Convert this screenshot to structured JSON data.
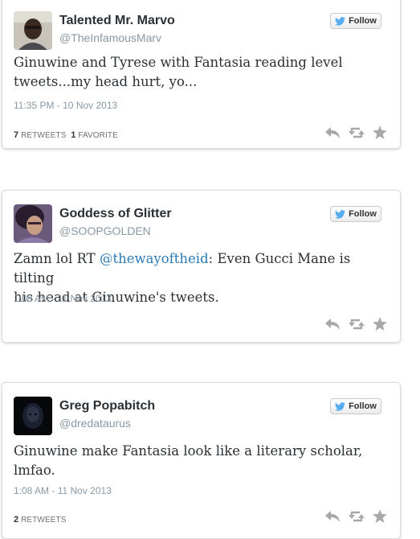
{
  "colors": {
    "follow_bird": "#55acee",
    "mention": "#2b7bb9",
    "icon_gray": "#a8a8a8"
  },
  "tweets": [
    {
      "name": "Talented Mr. Marvo",
      "handle": "@TheInfamousMarv",
      "follow_label": "Follow",
      "text_line1": "Ginuwine and Tyrese with Fantasia reading level",
      "text_line2": "tweets...my head hurt, yo...",
      "timestamp": "11:35 PM - 10 Nov 2013",
      "retweets_count": "7",
      "retweets_label": "RETWEETS",
      "favorites_count": "1",
      "favorites_label": "FAVORITE"
    },
    {
      "name": "Goddess of Glitter",
      "handle": "@SOOPGOLDEN",
      "follow_label": "Follow",
      "text_prefix": "Zamn lol RT ",
      "text_mention": "@thewayoftheid",
      "text_rest": ": Even Gucci Mane is tilting",
      "text_line2": "his head at Ginuwine's tweets.",
      "timestamp": "1:08 AM - 11 Nov 2013"
    },
    {
      "name": "Greg Popabitch",
      "handle": "@dredataurus",
      "follow_label": "Follow",
      "text_line1": "Ginuwine make Fantasia look like a literary scholar,",
      "text_line2": "lmfao.",
      "timestamp": "1:08 AM - 11 Nov 2013",
      "retweets_count": "2",
      "retweets_label": "RETWEETS"
    }
  ]
}
